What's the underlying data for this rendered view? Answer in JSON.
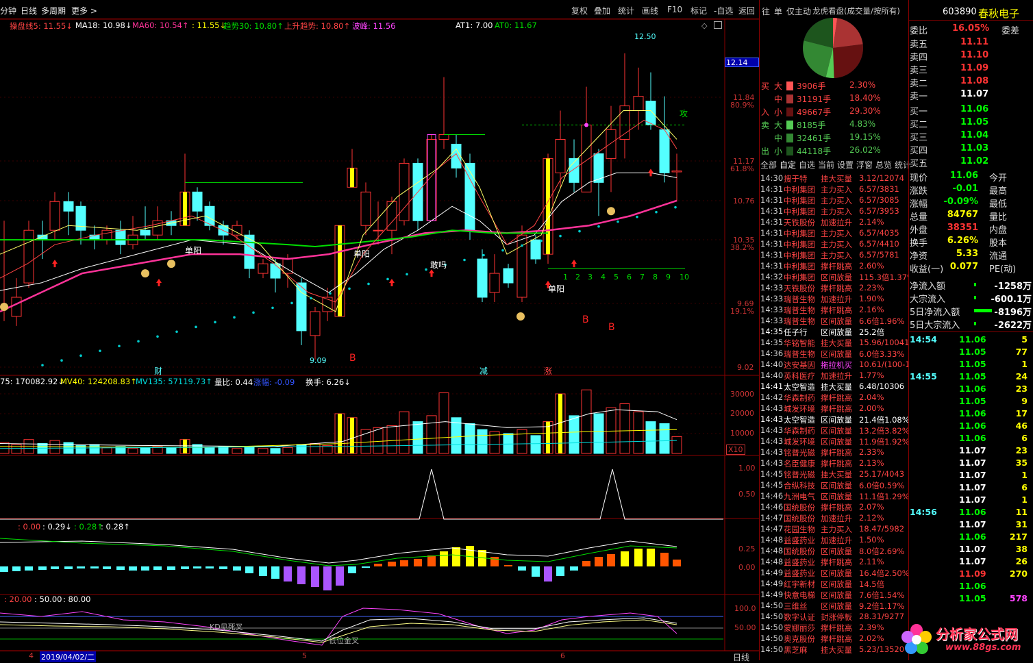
{
  "toolbar": {
    "left": [
      "分钟",
      "日线",
      "多周期",
      "更多 >"
    ],
    "right": [
      "复权",
      "叠加",
      "统计",
      "画线",
      "F10",
      "标记",
      "-自选",
      "返回"
    ],
    "mid_tabs": [
      "往",
      "单",
      "仅主动",
      "龙虎看盘(成交量/按所有)"
    ]
  },
  "stock": {
    "code": "603890",
    "name": "春秋电子"
  },
  "legend_main": [
    {
      "text": "操盘线5: 11.55↓",
      "color": "#ff4444"
    },
    {
      "text": "MA18: 10.98↓",
      "color": "#ffffff"
    },
    {
      "text": "MA60: 10.54↑",
      "color": "#ff3399"
    },
    {
      "text": ": 11.55↓",
      "color": "#ffff00"
    },
    {
      "text": "趋势30: 10.80↑",
      "color": "#00dd00"
    },
    {
      "text": "上升趋势: 10.80↑",
      "color": "#ff4444"
    },
    {
      "text": "波峰: 11.56",
      "color": "#ff44ff"
    },
    {
      "text": "AT1: 7.00",
      "color": "#ffffff"
    },
    {
      "text": "AT0: 11.67",
      "color": "#00dd00"
    }
  ],
  "price_axis": [
    {
      "v": "12.14",
      "pct": ""
    },
    {
      "v": "11.84",
      "pct": "80.9%"
    },
    {
      "v": "11.17",
      "pct": "61.8%"
    },
    {
      "v": "10.76",
      "pct": ""
    },
    {
      "v": "10.35",
      "pct": "38.2%"
    },
    {
      "v": "9.69",
      "pct": "19.1%"
    },
    {
      "v": "9.02",
      "pct": ""
    }
  ],
  "chart_labels": {
    "high": "12.50",
    "low": "9.09",
    "attack": "攻",
    "danyang": "单阳",
    "diaoma": "敢吗",
    "counts": [
      "1",
      "2",
      "3",
      "4",
      "5",
      "6",
      "7",
      "8",
      "9",
      "10"
    ],
    "b": "B",
    "cai": "财",
    "jian": "减",
    "zhang": "涨"
  },
  "legend_vol": [
    {
      "text": "75: 170082.92↓",
      "color": "#ffffff"
    },
    {
      "text": "MV40: 124208.83↑",
      "color": "#ffff00"
    },
    {
      "text": "MV135: 57119.73↑",
      "color": "#00dddd"
    },
    {
      "text": "量比: 0.44",
      "color": "#ffffff"
    },
    {
      "text": "涨幅: -0.09",
      "color": "#3355ff"
    },
    {
      "text": "换手: 6.26↓",
      "color": "#ffffff"
    }
  ],
  "vol_axis": [
    "30000",
    "20000",
    "10000",
    "X10"
  ],
  "sig_axis": [
    "1.00",
    "0.50"
  ],
  "legend_macd": [
    {
      "text": ": 0.00",
      "color": "#ff4444"
    },
    {
      "text": ": 0.29↓",
      "color": "#ffffff"
    },
    {
      "text": ": 0.28↑",
      "color": "#00dd00"
    },
    {
      "text": ": 0.28↑",
      "color": "#ffffff"
    }
  ],
  "macd_axis": [
    "0.25",
    "0.00"
  ],
  "legend_kdj": [
    {
      "text": ": 20.00",
      "color": "#ff4444"
    },
    {
      "text": ": 50.00",
      "color": "#ffffff"
    },
    {
      "text": ": 80.00",
      "color": "#ffffff"
    }
  ],
  "kdj_axis": [
    "100.0",
    "50.00"
  ],
  "kdj_labels": {
    "dead": "KD见死叉",
    "gold": "低位金叉"
  },
  "date_axis": {
    "m4": "4",
    "date": "2019/04/02/二",
    "m5": "5",
    "m6": "6",
    "period": "日线"
  },
  "fund": {
    "buy": [
      {
        "side": "买",
        "size": "大",
        "vol": "3906手",
        "pct": "2.30%",
        "bar": "#ff5555"
      },
      {
        "side": "",
        "size": "中",
        "vol": "31191手",
        "pct": "18.40%",
        "bar": "#aa3333"
      },
      {
        "side": "入",
        "size": "小",
        "vol": "49667手",
        "pct": "29.30%",
        "bar": "#661111"
      }
    ],
    "sell": [
      {
        "side": "卖",
        "size": "大",
        "vol": "8185手",
        "pct": "4.83%",
        "bar": "#55cc55"
      },
      {
        "side": "",
        "size": "中",
        "vol": "32461手",
        "pct": "19.15%",
        "bar": "#338833"
      },
      {
        "side": "出",
        "size": "小",
        "vol": "44118手",
        "pct": "26.02%",
        "bar": "#1d551d"
      }
    ]
  },
  "ticker_tabs": [
    "全部",
    "自定",
    "自选",
    "当前",
    "设置",
    "浮窗",
    "总览",
    "统计"
  ],
  "ticker": [
    {
      "t": "14:30",
      "n": "搜于特",
      "a": "挂大买量",
      "v": "3.12/12074"
    },
    {
      "t": "14:31",
      "n": "中利集团",
      "a": "主力买入",
      "v": "6.57/3831"
    },
    {
      "t": "14:31",
      "n": "中利集团",
      "a": "主力买入",
      "v": "6.57/3085"
    },
    {
      "t": "14:31",
      "n": "中利集团",
      "a": "主力买入",
      "v": "6.57/3953"
    },
    {
      "t": "14:31",
      "n": "天铁股份",
      "a": "加速拉升",
      "v": "2.14%"
    },
    {
      "t": "14:31",
      "n": "中利集团",
      "a": "主力买入",
      "v": "6.57/4035"
    },
    {
      "t": "14:31",
      "n": "中利集团",
      "a": "主力买入",
      "v": "6.57/4410"
    },
    {
      "t": "14:31",
      "n": "中利集团",
      "a": "主力买入",
      "v": "6.57/5781"
    },
    {
      "t": "14:31",
      "n": "中利集团",
      "a": "撑杆跳高",
      "v": "2.60%"
    },
    {
      "t": "14:32",
      "n": "中利集团",
      "a": "区间放量",
      "v": "115.3倍1.37%"
    },
    {
      "t": "14:33",
      "n": "天铁股份",
      "a": "撑杆跳高",
      "v": "2.23%"
    },
    {
      "t": "14:33",
      "n": "瑞普生物",
      "a": "加速拉升",
      "v": "1.90%"
    },
    {
      "t": "14:33",
      "n": "瑞普生物",
      "a": "撑杆跳高",
      "v": "2.16%"
    },
    {
      "t": "14:33",
      "n": "瑞普生物",
      "a": "区间放量",
      "v": "6.6倍1.96%"
    },
    {
      "t": "14:35",
      "n": "任子行",
      "a": "区间放量",
      "v": "25.2倍"
    },
    {
      "t": "14:35",
      "n": "华铭智能",
      "a": "挂大买量",
      "v": "15.96/10041"
    },
    {
      "t": "14:36",
      "n": "瑞普生物",
      "a": "区间放量",
      "v": "6.0倍3.33%"
    },
    {
      "t": "14:40",
      "n": "达安基因",
      "a": "拖拉机买",
      "v": "10.61/(100-1"
    },
    {
      "t": "14:40",
      "n": "英科医疗",
      "a": "加速拉升",
      "v": "1.77%"
    },
    {
      "t": "14:41",
      "n": "太空智造",
      "a": "挂大买量",
      "v": "6.48/10306"
    },
    {
      "t": "14:42",
      "n": "华森制药",
      "a": "撑杆跳高",
      "v": "2.04%"
    },
    {
      "t": "14:43",
      "n": "城发环境",
      "a": "撑杆跳高",
      "v": "2.00%"
    },
    {
      "t": "14:43",
      "n": "太空智造",
      "a": "区间放量",
      "v": "21.4倍1.08%"
    },
    {
      "t": "14:43",
      "n": "华森制药",
      "a": "区间放量",
      "v": "13.2倍3.82%"
    },
    {
      "t": "14:43",
      "n": "城发环境",
      "a": "区间放量",
      "v": "11.9倍1.92%"
    },
    {
      "t": "14:43",
      "n": "铭普光磁",
      "a": "撑杆跳高",
      "v": "2.33%"
    },
    {
      "t": "14:43",
      "n": "名臣健康",
      "a": "撑杆跳高",
      "v": "2.13%"
    },
    {
      "t": "14:45",
      "n": "铭普光磁",
      "a": "挂大买量",
      "v": "25.17/4043"
    },
    {
      "t": "14:45",
      "n": "合纵科技",
      "a": "区间放量",
      "v": "6.0倍0.59%"
    },
    {
      "t": "14:46",
      "n": "九洲电气",
      "a": "区间放量",
      "v": "11.1倍1.29%"
    },
    {
      "t": "14:46",
      "n": "国统股份",
      "a": "撑杆跳高",
      "v": "2.07%"
    },
    {
      "t": "14:47",
      "n": "国统股份",
      "a": "加速拉升",
      "v": "2.12%"
    },
    {
      "t": "14:47",
      "n": "花园生物",
      "a": "主力买入",
      "v": "18.47/5982"
    },
    {
      "t": "14:48",
      "n": "益盛药业",
      "a": "加速拉升",
      "v": "1.50%"
    },
    {
      "t": "14:48",
      "n": "国统股份",
      "a": "区间放量",
      "v": "8.0倍2.69%"
    },
    {
      "t": "14:48",
      "n": "益盛药业",
      "a": "撑杆跳高",
      "v": "2.11%"
    },
    {
      "t": "14:49",
      "n": "益盛药业",
      "a": "区间放量",
      "v": "16.4倍2.50%"
    },
    {
      "t": "14:49",
      "n": "红宇新材",
      "a": "区间放量",
      "v": "14.5倍"
    },
    {
      "t": "14:49",
      "n": "快意电梯",
      "a": "区间放量",
      "v": "7.6倍1.54%"
    },
    {
      "t": "14:50",
      "n": "三维丝",
      "a": "区间放量",
      "v": "9.2倍1.17%"
    },
    {
      "t": "14:50",
      "n": "数字认证",
      "a": "封涨停板",
      "v": "28.31/9277"
    },
    {
      "t": "14:50",
      "n": "蒙娜丽莎",
      "a": "撑杆跳高",
      "v": "2.39%"
    },
    {
      "t": "14:50",
      "n": "奥克股份",
      "a": "撑杆跳高",
      "v": "2.02%"
    },
    {
      "t": "14:50",
      "n": "黑芝麻",
      "a": "挂大买量",
      "v": "5.23/13520"
    }
  ],
  "quote": {
    "weibi": {
      "label": "委比",
      "v": "16.05%",
      "label2": "委差"
    },
    "sells": [
      {
        "l": "卖五",
        "p": "11.11"
      },
      {
        "l": "卖四",
        "p": "11.10"
      },
      {
        "l": "卖三",
        "p": "11.09"
      },
      {
        "l": "卖二",
        "p": "11.08"
      },
      {
        "l": "卖一",
        "p": "11.07"
      }
    ],
    "buys": [
      {
        "l": "买一",
        "p": "11.06"
      },
      {
        "l": "买二",
        "p": "11.05"
      },
      {
        "l": "买三",
        "p": "11.04"
      },
      {
        "l": "买四",
        "p": "11.03"
      },
      {
        "l": "买五",
        "p": "11.02"
      }
    ],
    "stats": [
      {
        "l": "现价",
        "v": "11.06",
        "r": "今开",
        "c": "#00ff00"
      },
      {
        "l": "涨跌",
        "v": "-0.01",
        "r": "最高",
        "c": "#00ff00"
      },
      {
        "l": "涨幅",
        "v": "-0.09%",
        "r": "最低",
        "c": "#00ff00"
      },
      {
        "l": "总量",
        "v": "84767",
        "r": "量比",
        "c": "#ffff00"
      },
      {
        "l": "外盘",
        "v": "38351",
        "r": "内盘",
        "c": "#ff3333"
      },
      {
        "l": "换手",
        "v": "6.26%",
        "r": "股本",
        "c": "#ffff00"
      },
      {
        "l": "净资",
        "v": "5.33",
        "r": "流通",
        "c": "#ffff00"
      },
      {
        "l": "收益(一)",
        "v": "0.077",
        "r": "PE(动)",
        "c": "#ffff00"
      }
    ],
    "flows": [
      {
        "l": "净流入额",
        "v": "-1258万"
      },
      {
        "l": "大宗流入",
        "v": "-600.1万"
      },
      {
        "l": "5日净流入额",
        "v": "-8196万"
      },
      {
        "l": "5日大宗流入",
        "v": "-2622万"
      }
    ]
  },
  "trades": [
    {
      "t": "14:54",
      "p": "11.06",
      "v": "5",
      "pc": "#00ff00",
      "vc": "#ffff00"
    },
    {
      "t": "",
      "p": "11.05",
      "v": "77",
      "pc": "#00ff00",
      "vc": "#ffff00"
    },
    {
      "t": "",
      "p": "11.05",
      "v": "1",
      "pc": "#00ff00",
      "vc": "#ffff00"
    },
    {
      "t": "14:55",
      "p": "11.05",
      "v": "24",
      "pc": "#00ff00",
      "vc": "#ffff00"
    },
    {
      "t": "",
      "p": "11.06",
      "v": "23",
      "pc": "#00ff00",
      "vc": "#ffff00"
    },
    {
      "t": "",
      "p": "11.05",
      "v": "9",
      "pc": "#00ff00",
      "vc": "#ffff00"
    },
    {
      "t": "",
      "p": "11.06",
      "v": "17",
      "pc": "#00ff00",
      "vc": "#ffff00"
    },
    {
      "t": "",
      "p": "11.06",
      "v": "46",
      "pc": "#00ff00",
      "vc": "#ffff00"
    },
    {
      "t": "",
      "p": "11.06",
      "v": "6",
      "pc": "#00ff00",
      "vc": "#ffff00"
    },
    {
      "t": "",
      "p": "11.07",
      "v": "23",
      "pc": "#ffffff",
      "vc": "#ffff00"
    },
    {
      "t": "",
      "p": "11.07",
      "v": "35",
      "pc": "#ffffff",
      "vc": "#ffff00"
    },
    {
      "t": "",
      "p": "11.07",
      "v": "1",
      "pc": "#ffffff",
      "vc": "#ffff00"
    },
    {
      "t": "",
      "p": "11.07",
      "v": "6",
      "pc": "#ffffff",
      "vc": "#ffff00"
    },
    {
      "t": "",
      "p": "11.07",
      "v": "1",
      "pc": "#ffffff",
      "vc": "#ffff00"
    },
    {
      "t": "14:56",
      "p": "11.06",
      "v": "11",
      "pc": "#00ff00",
      "vc": "#ffff00"
    },
    {
      "t": "",
      "p": "11.07",
      "v": "31",
      "pc": "#ffffff",
      "vc": "#ffff00"
    },
    {
      "t": "",
      "p": "11.06",
      "v": "217",
      "pc": "#00ff00",
      "vc": "#ffff00"
    },
    {
      "t": "",
      "p": "11.07",
      "v": "38",
      "pc": "#ffffff",
      "vc": "#ffff00"
    },
    {
      "t": "",
      "p": "11.07",
      "v": "26",
      "pc": "#ffffff",
      "vc": "#ffff00"
    },
    {
      "t": "",
      "p": "11.09",
      "v": "270",
      "pc": "#ff3333",
      "vc": "#ffff00"
    },
    {
      "t": "",
      "p": "11.06",
      "v": "",
      "pc": "#00ff00",
      "vc": "#ffff00"
    },
    {
      "t": "",
      "p": "11.05",
      "v": "578",
      "pc": "#00ff00",
      "vc": "#ff44ff"
    }
  ],
  "watermark": {
    "cn": "分析家公式网",
    "url": "www.88gs.com"
  },
  "colors": {
    "up": "#ff3333",
    "down": "#54ffff",
    "grid": "#8b0000"
  }
}
